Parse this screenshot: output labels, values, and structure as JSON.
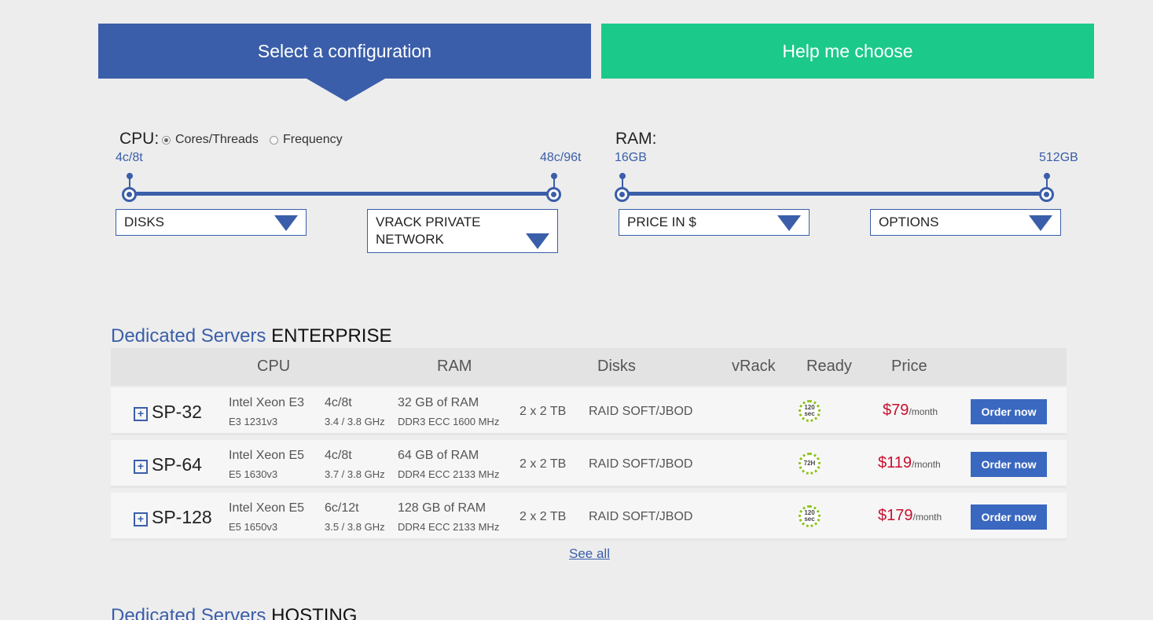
{
  "tabs": {
    "select": "Select a configuration",
    "help": "Help me choose"
  },
  "cpu": {
    "label": "CPU:",
    "options": [
      "Cores/Threads",
      "Frequency"
    ],
    "selected": "Cores/Threads",
    "min": "4c/8t",
    "max": "48c/96t"
  },
  "ram": {
    "label": "RAM:",
    "min": "16GB",
    "max": "512GB"
  },
  "filters": {
    "disks": "DISKS",
    "vrack": "VRACK PRIVATE NETWORK",
    "price": "PRICE IN $",
    "options": "OPTIONS"
  },
  "sections": {
    "enterprise": {
      "title_a": "Dedicated Servers",
      "title_b": "ENTERPRISE"
    },
    "hosting": {
      "title_a": "Dedicated Servers",
      "title_b": "HOSTING"
    }
  },
  "table": {
    "headers": {
      "cpu": "CPU",
      "ram": "RAM",
      "disks": "Disks",
      "vrack": "vRack",
      "ready": "Ready",
      "price": "Price"
    },
    "rows": [
      {
        "name": "SP-32",
        "cpu_model": "Intel  Xeon E3",
        "cpu_sub": "E3 1231v3",
        "cores": "4c/8t",
        "freq": "3.4 / 3.8 GHz",
        "ram": "32 GB of RAM",
        "ram_sub": "DDR3 ECC 1600 MHz",
        "disks": "2 x 2 TB",
        "raid": "RAID SOFT/JBOD",
        "ready": "120 sec",
        "price": "$79",
        "per": "/month",
        "order": "Order now"
      },
      {
        "name": "SP-64",
        "cpu_model": "Intel  Xeon E5",
        "cpu_sub": "E5 1630v3",
        "cores": "4c/8t",
        "freq": "3.7 / 3.8 GHz",
        "ram": "64 GB of RAM",
        "ram_sub": "DDR4 ECC 2133 MHz",
        "disks": "2 x 2 TB",
        "raid": "RAID SOFT/JBOD",
        "ready": "72H",
        "price": "$119",
        "per": "/month",
        "order": "Order now"
      },
      {
        "name": "SP-128",
        "cpu_model": "Intel  Xeon E5",
        "cpu_sub": "E5 1650v3",
        "cores": "6c/12t",
        "freq": "3.5 / 3.8 GHz",
        "ram": "128 GB of RAM",
        "ram_sub": "DDR4 ECC 2133 MHz",
        "disks": "2 x 2 TB",
        "raid": "RAID SOFT/JBOD",
        "ready": "120 sec",
        "price": "$179",
        "per": "/month",
        "order": "Order now"
      }
    ]
  },
  "see_all": "See all",
  "colors": {
    "primary": "#3a5ea9",
    "accent": "#1bc98b",
    "price": "#c8102e",
    "ready": "#8bc21c"
  }
}
